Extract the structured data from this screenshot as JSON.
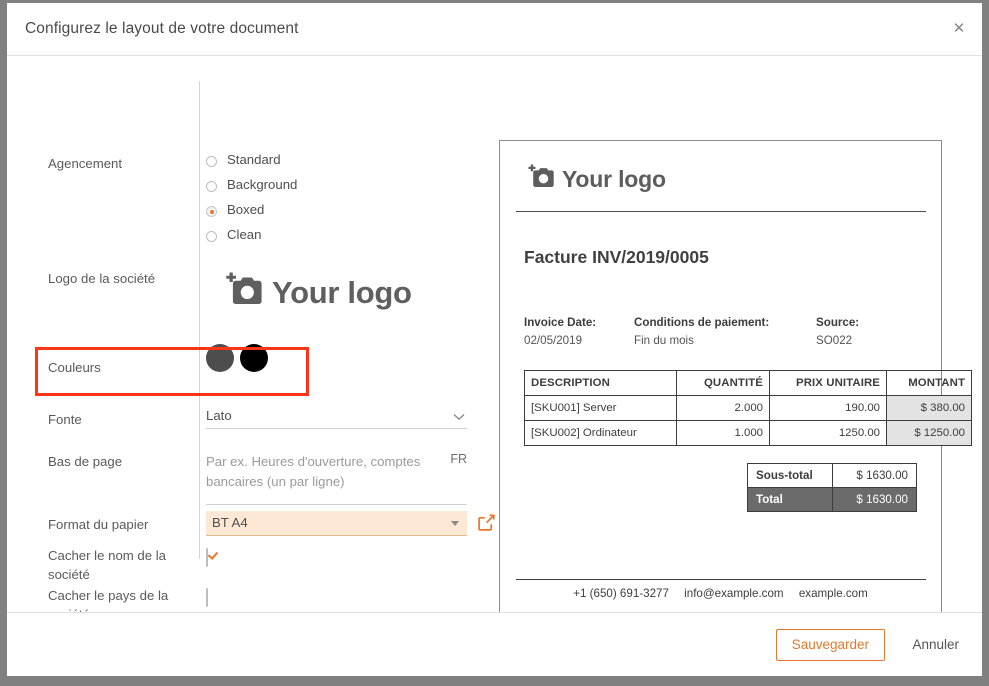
{
  "dialog": {
    "title": "Configurez le layout de votre document",
    "close_icon": "close-icon"
  },
  "form": {
    "layout": {
      "label": "Agencement",
      "options": [
        {
          "label": "Standard",
          "selected": false
        },
        {
          "label": "Background",
          "selected": false
        },
        {
          "label": "Boxed",
          "selected": true
        },
        {
          "label": "Clean",
          "selected": false
        }
      ]
    },
    "logo": {
      "label": "Logo de la société",
      "placeholder_text": "Your logo",
      "icon": "camera-add-icon"
    },
    "colors": {
      "label": "Couleurs",
      "swatches": [
        "#4d4d4d",
        "#000000"
      ],
      "highlighted": true
    },
    "font": {
      "label": "Fonte",
      "value": "Lato"
    },
    "footer_text": {
      "label": "Bas de page",
      "placeholder": "Par ex. Heures d'ouverture, comptes bancaires (un par ligne)",
      "lang": "FR"
    },
    "paper_format": {
      "label": "Format du papier",
      "value": "BT A4",
      "external_link_icon": "external-link-icon"
    },
    "hide_company_name": {
      "label": "Cacher le nom de la société",
      "checked": true
    },
    "hide_company_country": {
      "label": "Cacher le pays de la société",
      "checked": false
    }
  },
  "preview": {
    "logo_text": "Your logo",
    "logo_icon": "camera-add-icon",
    "title": "Facture INV/2019/0005",
    "meta": [
      {
        "label": "Invoice Date:",
        "value": "02/05/2019"
      },
      {
        "label": "Conditions de paiement:",
        "value": "Fin du mois"
      },
      {
        "label": "Source:",
        "value": "SO022"
      }
    ],
    "table": {
      "headers": [
        "DESCRIPTION",
        "QUANTITÉ",
        "PRIX UNITAIRE",
        "MONTANT"
      ],
      "rows": [
        [
          "[SKU001] Server",
          "2.000",
          "190.00",
          "$ 380.00"
        ],
        [
          "[SKU002] Ordinateur",
          "1.000",
          "1250.00",
          "$ 1250.00"
        ]
      ]
    },
    "totals": [
      {
        "label": "Sous-total",
        "value": "$ 1630.00"
      },
      {
        "label": "Total",
        "value": "$ 1630.00"
      }
    ],
    "footer": {
      "phone": "+1 (650) 691-3277",
      "email": "info@example.com",
      "website": "example.com"
    }
  },
  "actions": {
    "save": "Sauvegarder",
    "cancel": "Annuler"
  }
}
